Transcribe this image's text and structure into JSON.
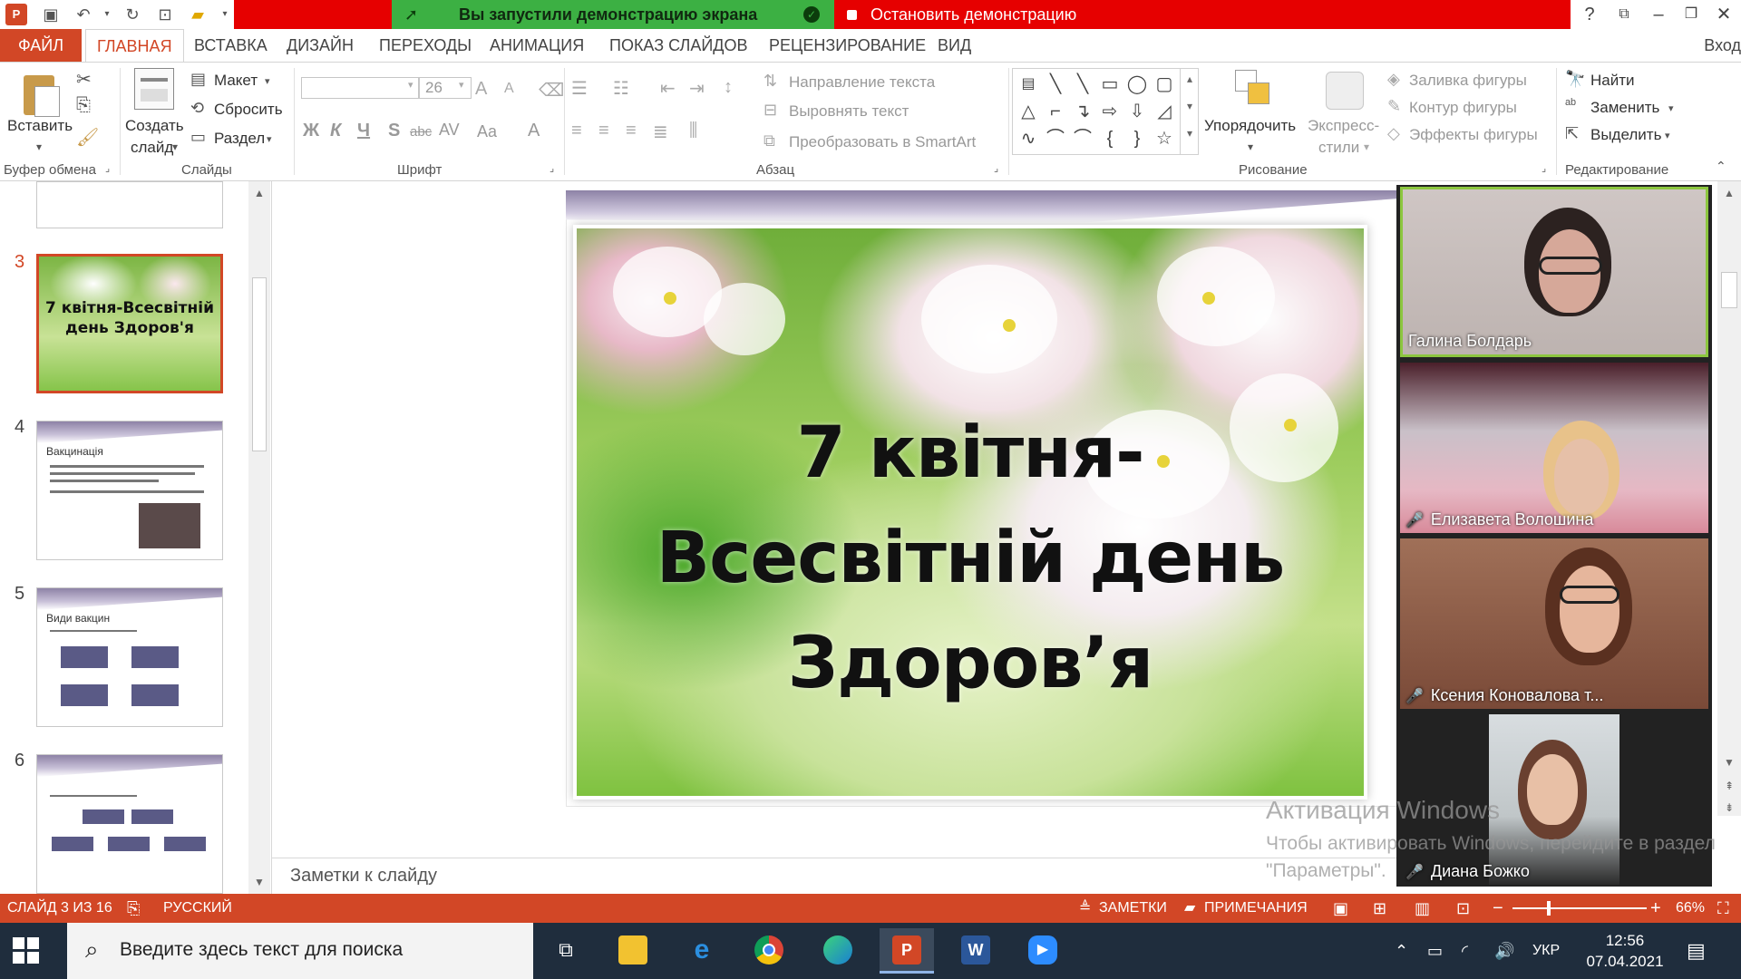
{
  "titlebar": {
    "share_status": "Вы запустили демонстрацию экрана",
    "stop_share": "Остановить демонстрацию",
    "help": "?",
    "colors": {
      "share_bar": "#e60000",
      "share_status_bg": "#3cb043"
    }
  },
  "tabs": {
    "file": "ФАЙЛ",
    "items": [
      "ГЛАВНАЯ",
      "ВСТАВКА",
      "ДИЗАЙН",
      "ПЕРЕХОДЫ",
      "АНИМАЦИЯ",
      "ПОКАЗ СЛАЙДОВ",
      "РЕЦЕНЗИРОВАНИЕ",
      "ВИД"
    ],
    "active": "ГЛАВНАЯ",
    "signin": "Вход",
    "accent": "#d24726"
  },
  "ribbon": {
    "clipboard": {
      "paste": "Вставить",
      "label": "Буфер обмена"
    },
    "slides": {
      "new_slide_1": "Создать",
      "new_slide_2": "слайд",
      "layout": "Макет",
      "reset": "Сбросить",
      "section": "Раздел",
      "label": "Слайды"
    },
    "font": {
      "size": "26",
      "bold": "Ж",
      "italic": "К",
      "underline": "Ч",
      "shadow": "S",
      "strike": "abc",
      "spacing": "AV",
      "case": "Aa",
      "color": "A",
      "label": "Шрифт"
    },
    "paragraph": {
      "text_dir": "Направление текста",
      "align_text": "Выровнять текст",
      "smartart": "Преобразовать в SmartArt",
      "label": "Абзац"
    },
    "drawing": {
      "arrange": "Упорядочить",
      "quick_styles_1": "Экспресс-",
      "quick_styles_2": "стили",
      "fill": "Заливка фигуры",
      "outline": "Контур фигуры",
      "effects": "Эффекты фигуры",
      "label": "Рисование"
    },
    "editing": {
      "find": "Найти",
      "replace": "Заменить",
      "select": "Выделить",
      "label": "Редактирование"
    }
  },
  "thumbnails": [
    {
      "num": "3",
      "title": "7 квітня-Всесвітній день Здоров'я",
      "selected": true
    },
    {
      "num": "4",
      "title": "Вакцинація"
    },
    {
      "num": "5",
      "title": "Види вакцин"
    },
    {
      "num": "6",
      "title": ""
    }
  ],
  "slide": {
    "line1": "7 квітня-",
    "line2": "Всесвітній день",
    "line3": "Здоров’я"
  },
  "notes": {
    "placeholder": "Заметки к слайду"
  },
  "participants": [
    {
      "name": "Галина Болдарь",
      "muted": false,
      "active": true
    },
    {
      "name": "Елизавета Волошина",
      "muted": true
    },
    {
      "name": "Ксения Коновалова т...",
      "muted": true
    },
    {
      "name": "Диана Божко",
      "muted": true
    }
  ],
  "watermark": {
    "title": "Активация Windows",
    "text": "Чтобы активировать Windows, перейдите в раздел \"Параметры\"."
  },
  "statusbar": {
    "slide_info": "СЛАЙД 3 ИЗ 16",
    "language": "РУССКИЙ",
    "notes": "ЗАМЕТКИ",
    "comments": "ПРИМЕЧАНИЯ",
    "zoom": "66%"
  },
  "taskbar": {
    "search_placeholder": "Введите здесь текст для поиска",
    "lang": "УКР",
    "time": "12:56",
    "date": "07.04.2021"
  }
}
